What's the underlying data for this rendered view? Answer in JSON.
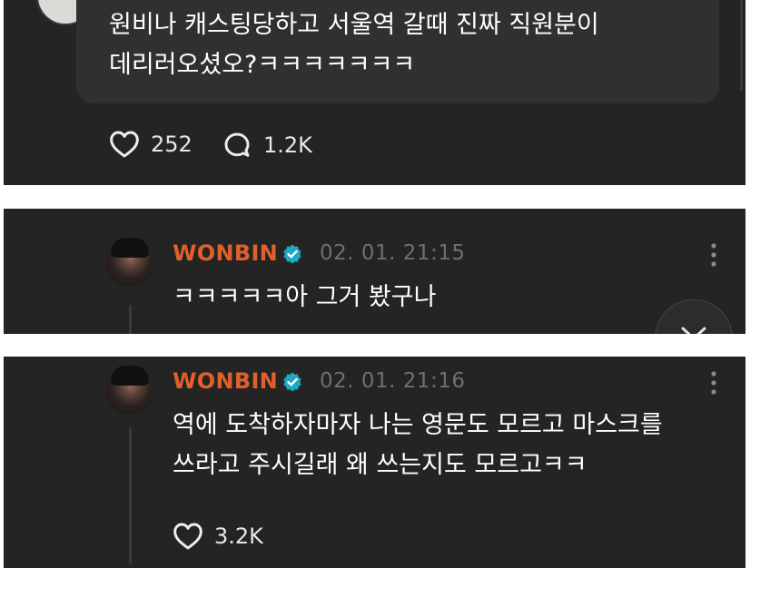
{
  "post": {
    "text": "원비나 캐스팅당하고 서울역 갈때 진짜 직원분이\n데리러오셨오?ㅋㅋㅋㅋㅋㅋㅋ",
    "likes": "252",
    "comments": "1.2K"
  },
  "replies": [
    {
      "author": "WONBIN",
      "time": "02. 01. 21:15",
      "text": "ㅋㅋㅋㅋㅋ아 그거 봤구나"
    },
    {
      "author": "WONBIN",
      "time": "02. 01. 21:16",
      "text": "역에 도착하자마자 나는 영문도 모르고 마스크를\n쓰라고 주시길래 왜 쓰는지도 모르고ㅋㅋ",
      "likes": "3.2K"
    }
  ],
  "colors": {
    "accent_name": "#e0602c",
    "verified": "#1fa9c6",
    "background": "#242424"
  },
  "icons": [
    "heart-icon",
    "comment-icon",
    "verified-icon",
    "more-icon",
    "chevron-down-icon"
  ]
}
